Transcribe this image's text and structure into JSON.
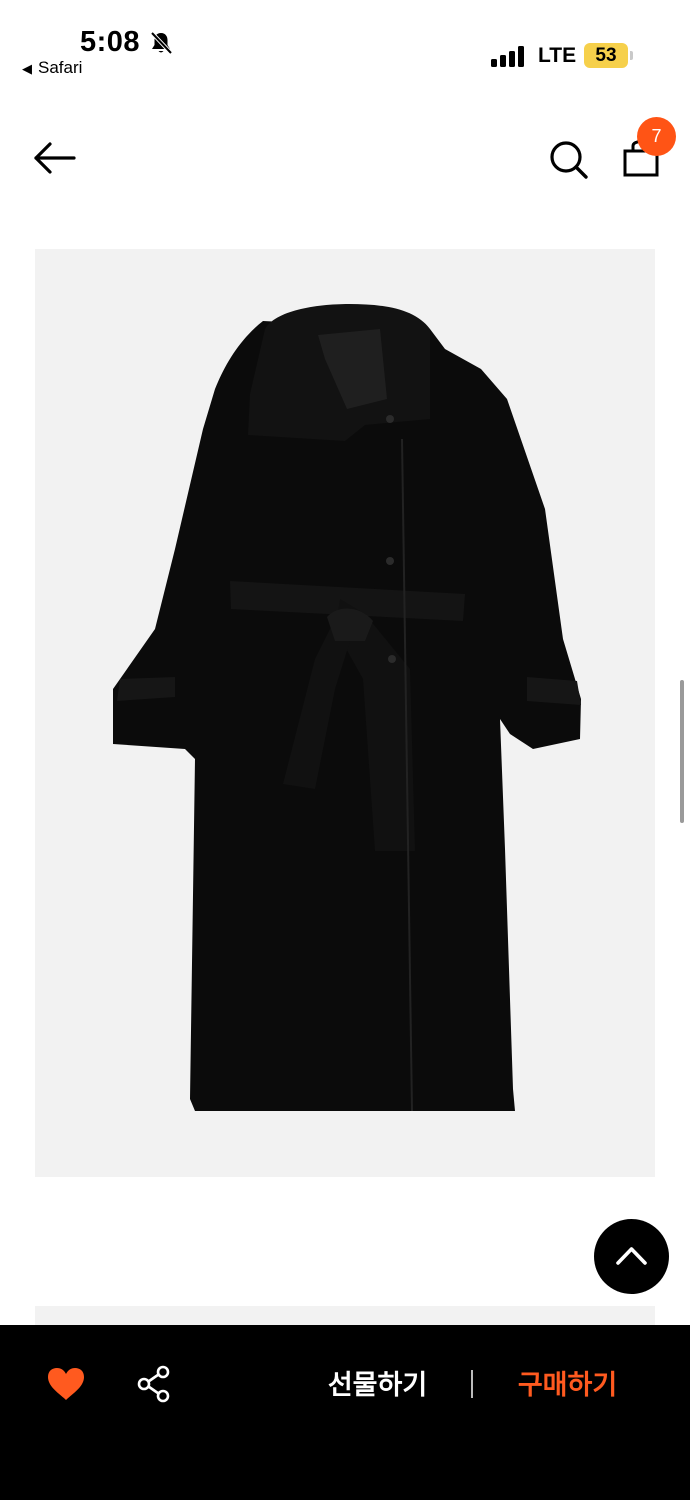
{
  "status_bar": {
    "time": "5:08",
    "back_app_label": "Safari",
    "network": "LTE",
    "battery": "53",
    "battery_color": "#f6d04b",
    "icons": [
      "bell-slash-icon",
      "signal-icon"
    ]
  },
  "header": {
    "back_icon": "arrow-left-icon",
    "search_icon": "search-icon",
    "bag_icon": "shopping-bag-icon",
    "bag_count": "7",
    "badge_color": "#ff5415"
  },
  "product": {
    "image_icon": "black-belted-wool-coat-image"
  },
  "scroll_top": {
    "icon": "chevron-up-icon"
  },
  "bottom_bar": {
    "like_icon": "heart-icon",
    "like_color": "#ff5a1f",
    "share_icon": "share-icon",
    "gift_label": "선물하기",
    "buy_label": "구매하기",
    "buy_color": "#ff5a1f"
  }
}
